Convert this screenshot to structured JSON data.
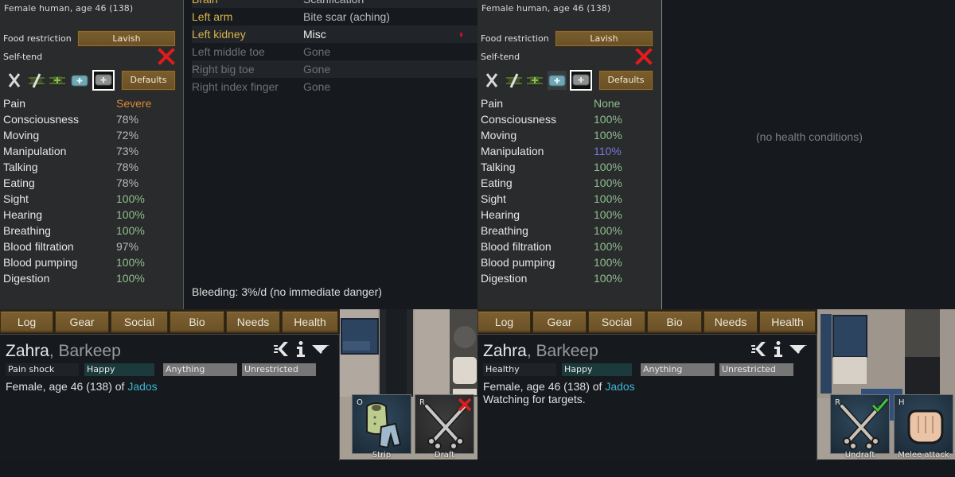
{
  "colors": {
    "severe": "#d98a33",
    "good": "#8fbf8f",
    "neutral": "#b9b9b9",
    "enhanced": "#7a78d8",
    "hediff_highlight": "#d9b54a",
    "hediff_normal": "#dcdcdc",
    "hediff_gone": "#6f7072",
    "faction_link": "#3eb6d0"
  },
  "left": {
    "health": {
      "summary": "Female human, age 46 (138)",
      "food_restriction_label": "Food restriction",
      "food_restriction_value": "Lavish",
      "self_tend_label": "Self-tend",
      "self_tend_state": "off",
      "care_icons": [
        "no-care-icon",
        "no-meds-icon",
        "herbal-medicine-icon",
        "industrial-medicine-icon",
        "glitterworld-medicine-icon"
      ],
      "care_selected": "glitterworld-medicine-icon",
      "defaults_label": "Defaults",
      "capacities": [
        {
          "name": "Pain",
          "value": "Severe",
          "tone": "severe"
        },
        {
          "name": "Consciousness",
          "value": "78%",
          "tone": "neutral"
        },
        {
          "name": "Moving",
          "value": "72%",
          "tone": "neutral"
        },
        {
          "name": "Manipulation",
          "value": "73%",
          "tone": "neutral"
        },
        {
          "name": "Talking",
          "value": "78%",
          "tone": "neutral"
        },
        {
          "name": "Eating",
          "value": "78%",
          "tone": "neutral"
        },
        {
          "name": "Sight",
          "value": "100%",
          "tone": "good"
        },
        {
          "name": "Hearing",
          "value": "100%",
          "tone": "good"
        },
        {
          "name": "Breathing",
          "value": "100%",
          "tone": "good"
        },
        {
          "name": "Blood filtration",
          "value": "97%",
          "tone": "neutral"
        },
        {
          "name": "Blood pumping",
          "value": "100%",
          "tone": "good"
        },
        {
          "name": "Digestion",
          "value": "100%",
          "tone": "good"
        }
      ],
      "hediffs": [
        {
          "part": "Brain",
          "condition": "Scarification",
          "tone": "normal",
          "part_tone": "highlight"
        },
        {
          "part": "Left arm",
          "condition": "Bite scar (aching)",
          "tone": "normal",
          "part_tone": "highlight"
        },
        {
          "part": "Left kidney",
          "condition": "Misc",
          "tone": "bright",
          "part_tone": "highlight",
          "bleeding_marker": true
        },
        {
          "part": "Left middle toe",
          "condition": "Gone",
          "tone": "gone",
          "part_tone": "gone"
        },
        {
          "part": "Right big toe",
          "condition": "Gone",
          "tone": "gone",
          "part_tone": "gone"
        },
        {
          "part": "Right index finger",
          "condition": "Gone",
          "tone": "gone",
          "part_tone": "gone"
        }
      ],
      "bleeding": "Bleeding: 3%/d (no immediate danger)"
    },
    "tabs": [
      "Log",
      "Gear",
      "Social",
      "Bio",
      "Needs",
      "Health"
    ],
    "pawn": {
      "name": "Zahra",
      "separator": ", ",
      "title": "Barkeep",
      "tags": [
        "Pain shock",
        "Happy",
        "Anything",
        "Unrestricted"
      ],
      "description": "Female, age 46 (138) of ",
      "faction": "Jados",
      "activity": ""
    },
    "commands": [
      {
        "key": "O",
        "label": "Strip",
        "icon": "strip-clothes-icon"
      },
      {
        "key": "R",
        "label": "Draft",
        "icon": "draft-swords-icon",
        "status": "off"
      }
    ]
  },
  "right": {
    "health": {
      "summary": "Female human, age 46 (138)",
      "food_restriction_label": "Food restriction",
      "food_restriction_value": "Lavish",
      "self_tend_label": "Self-tend",
      "self_tend_state": "off",
      "care_icons": [
        "no-care-icon",
        "no-meds-icon",
        "herbal-medicine-icon",
        "industrial-medicine-icon",
        "glitterworld-medicine-icon"
      ],
      "care_selected": "glitterworld-medicine-icon",
      "defaults_label": "Defaults",
      "capacities": [
        {
          "name": "Pain",
          "value": "None",
          "tone": "good"
        },
        {
          "name": "Consciousness",
          "value": "100%",
          "tone": "good"
        },
        {
          "name": "Moving",
          "value": "100%",
          "tone": "good"
        },
        {
          "name": "Manipulation",
          "value": "110%",
          "tone": "enhanced"
        },
        {
          "name": "Talking",
          "value": "100%",
          "tone": "good"
        },
        {
          "name": "Eating",
          "value": "100%",
          "tone": "good"
        },
        {
          "name": "Sight",
          "value": "100%",
          "tone": "good"
        },
        {
          "name": "Hearing",
          "value": "100%",
          "tone": "good"
        },
        {
          "name": "Breathing",
          "value": "100%",
          "tone": "good"
        },
        {
          "name": "Blood filtration",
          "value": "100%",
          "tone": "good"
        },
        {
          "name": "Blood pumping",
          "value": "100%",
          "tone": "good"
        },
        {
          "name": "Digestion",
          "value": "100%",
          "tone": "good"
        }
      ],
      "no_conditions": "(no health conditions)"
    },
    "tabs": [
      "Log",
      "Gear",
      "Social",
      "Bio",
      "Needs",
      "Health"
    ],
    "pawn": {
      "name": "Zahra",
      "separator": ", ",
      "title": "Barkeep",
      "tags": [
        "Healthy",
        "Happy",
        "Anything",
        "Unrestricted"
      ],
      "description": "Female, age 46 (138) of ",
      "faction": "Jados",
      "activity": "Watching for targets."
    },
    "commands": [
      {
        "key": "R",
        "label": "Undraft",
        "icon": "draft-swords-icon",
        "status": "on"
      },
      {
        "key": "H",
        "label": "Melee attack",
        "icon": "fist-icon"
      }
    ]
  }
}
